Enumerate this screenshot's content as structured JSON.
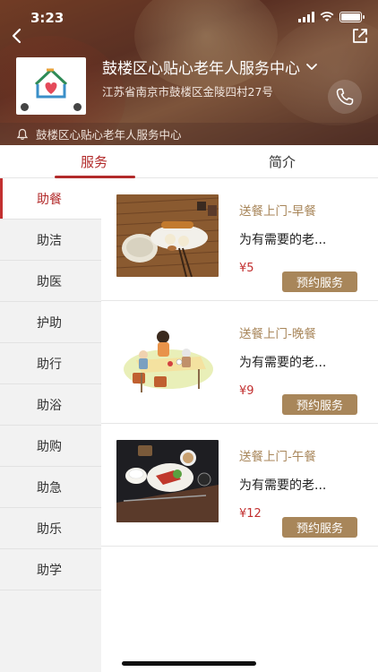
{
  "status_bar": {
    "time": "3:23"
  },
  "org": {
    "name": "鼓楼区心贴心老年人服务中心",
    "address": "江苏省南京市鼓楼区金陵四村27号",
    "notice": "鼓楼区心贴心老年人服务中心"
  },
  "tabs": [
    {
      "label": "服务",
      "active": true
    },
    {
      "label": "简介",
      "active": false
    }
  ],
  "sidebar": {
    "items": [
      {
        "label": "助餐",
        "active": true
      },
      {
        "label": "助洁"
      },
      {
        "label": "助医"
      },
      {
        "label": "护助"
      },
      {
        "label": "助行"
      },
      {
        "label": "助浴"
      },
      {
        "label": "助购"
      },
      {
        "label": "助急"
      },
      {
        "label": "助乐"
      },
      {
        "label": "助学"
      }
    ]
  },
  "services": [
    {
      "name": "送餐上门-早餐",
      "desc": "为有需要的老...",
      "price": "¥5",
      "button": "预约服务"
    },
    {
      "name": "送餐上门-晚餐",
      "desc": "为有需要的老...",
      "price": "¥9",
      "button": "预约服务"
    },
    {
      "name": "送餐上门-午餐",
      "desc": "为有需要的老...",
      "price": "¥12",
      "button": "预约服务"
    }
  ],
  "colors": {
    "accent": "#b22a2a",
    "gold": "#a8865a",
    "price": "#c23030"
  }
}
